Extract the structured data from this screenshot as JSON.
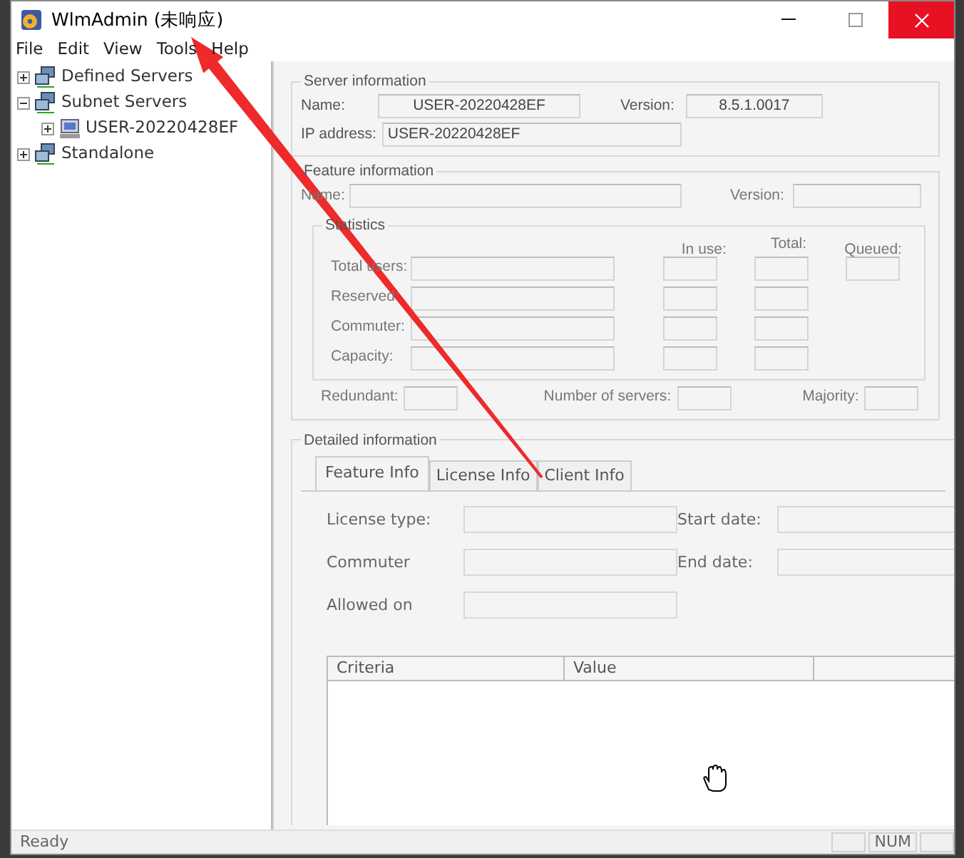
{
  "window": {
    "title": "WlmAdmin (未响应)"
  },
  "menu": [
    {
      "label": "File"
    },
    {
      "label": "Edit"
    },
    {
      "label": "View"
    },
    {
      "label": "Tools"
    },
    {
      "label": "Help"
    }
  ],
  "tree": [
    {
      "label": "Defined Servers",
      "expanded": false
    },
    {
      "label": "Subnet Servers",
      "expanded": true,
      "children": [
        {
          "label": "USER-20220428EF",
          "expanded": false
        }
      ]
    },
    {
      "label": "Standalone",
      "expanded": false
    }
  ],
  "server_information": {
    "title": "Server information",
    "name_label": "Name:",
    "name_value": "USER-20220428EF",
    "version_label": "Version:",
    "version_value": "8.5.1.0017",
    "ip_label": "IP address:",
    "ip_value": "USER-20220428EF"
  },
  "feature_information": {
    "title": "Feature information",
    "name_label": "Name:",
    "version_label": "Version:",
    "statistics": {
      "title": "Statistics",
      "columns": [
        "In use:",
        "Total:",
        "Queued:"
      ],
      "rows": [
        {
          "label": "Total users:",
          "has_queued": true
        },
        {
          "label": "Reserved:",
          "has_queued": false
        },
        {
          "label": "Commuter:",
          "has_queued": false
        },
        {
          "label": "Capacity:",
          "has_queued": false
        }
      ]
    },
    "footer_fields": [
      {
        "label": "Redundant:"
      },
      {
        "label": "Number of servers:"
      },
      {
        "label": "Majority:"
      }
    ]
  },
  "detailed_information": {
    "title": "Detailed information",
    "tabs": [
      {
        "label": "Feature Info",
        "selected": true
      },
      {
        "label": "License Info",
        "selected": false
      },
      {
        "label": "Client Info",
        "selected": false
      }
    ],
    "fields": [
      {
        "label": "License type:"
      },
      {
        "label": "Start date:"
      },
      {
        "label": "Commuter"
      },
      {
        "label": "End date:"
      },
      {
        "label": "Allowed on"
      }
    ],
    "table": {
      "columns": [
        "Criteria",
        "Value"
      ]
    }
  },
  "status_bar": {
    "text": "Ready",
    "indicators": [
      "NUM"
    ]
  }
}
